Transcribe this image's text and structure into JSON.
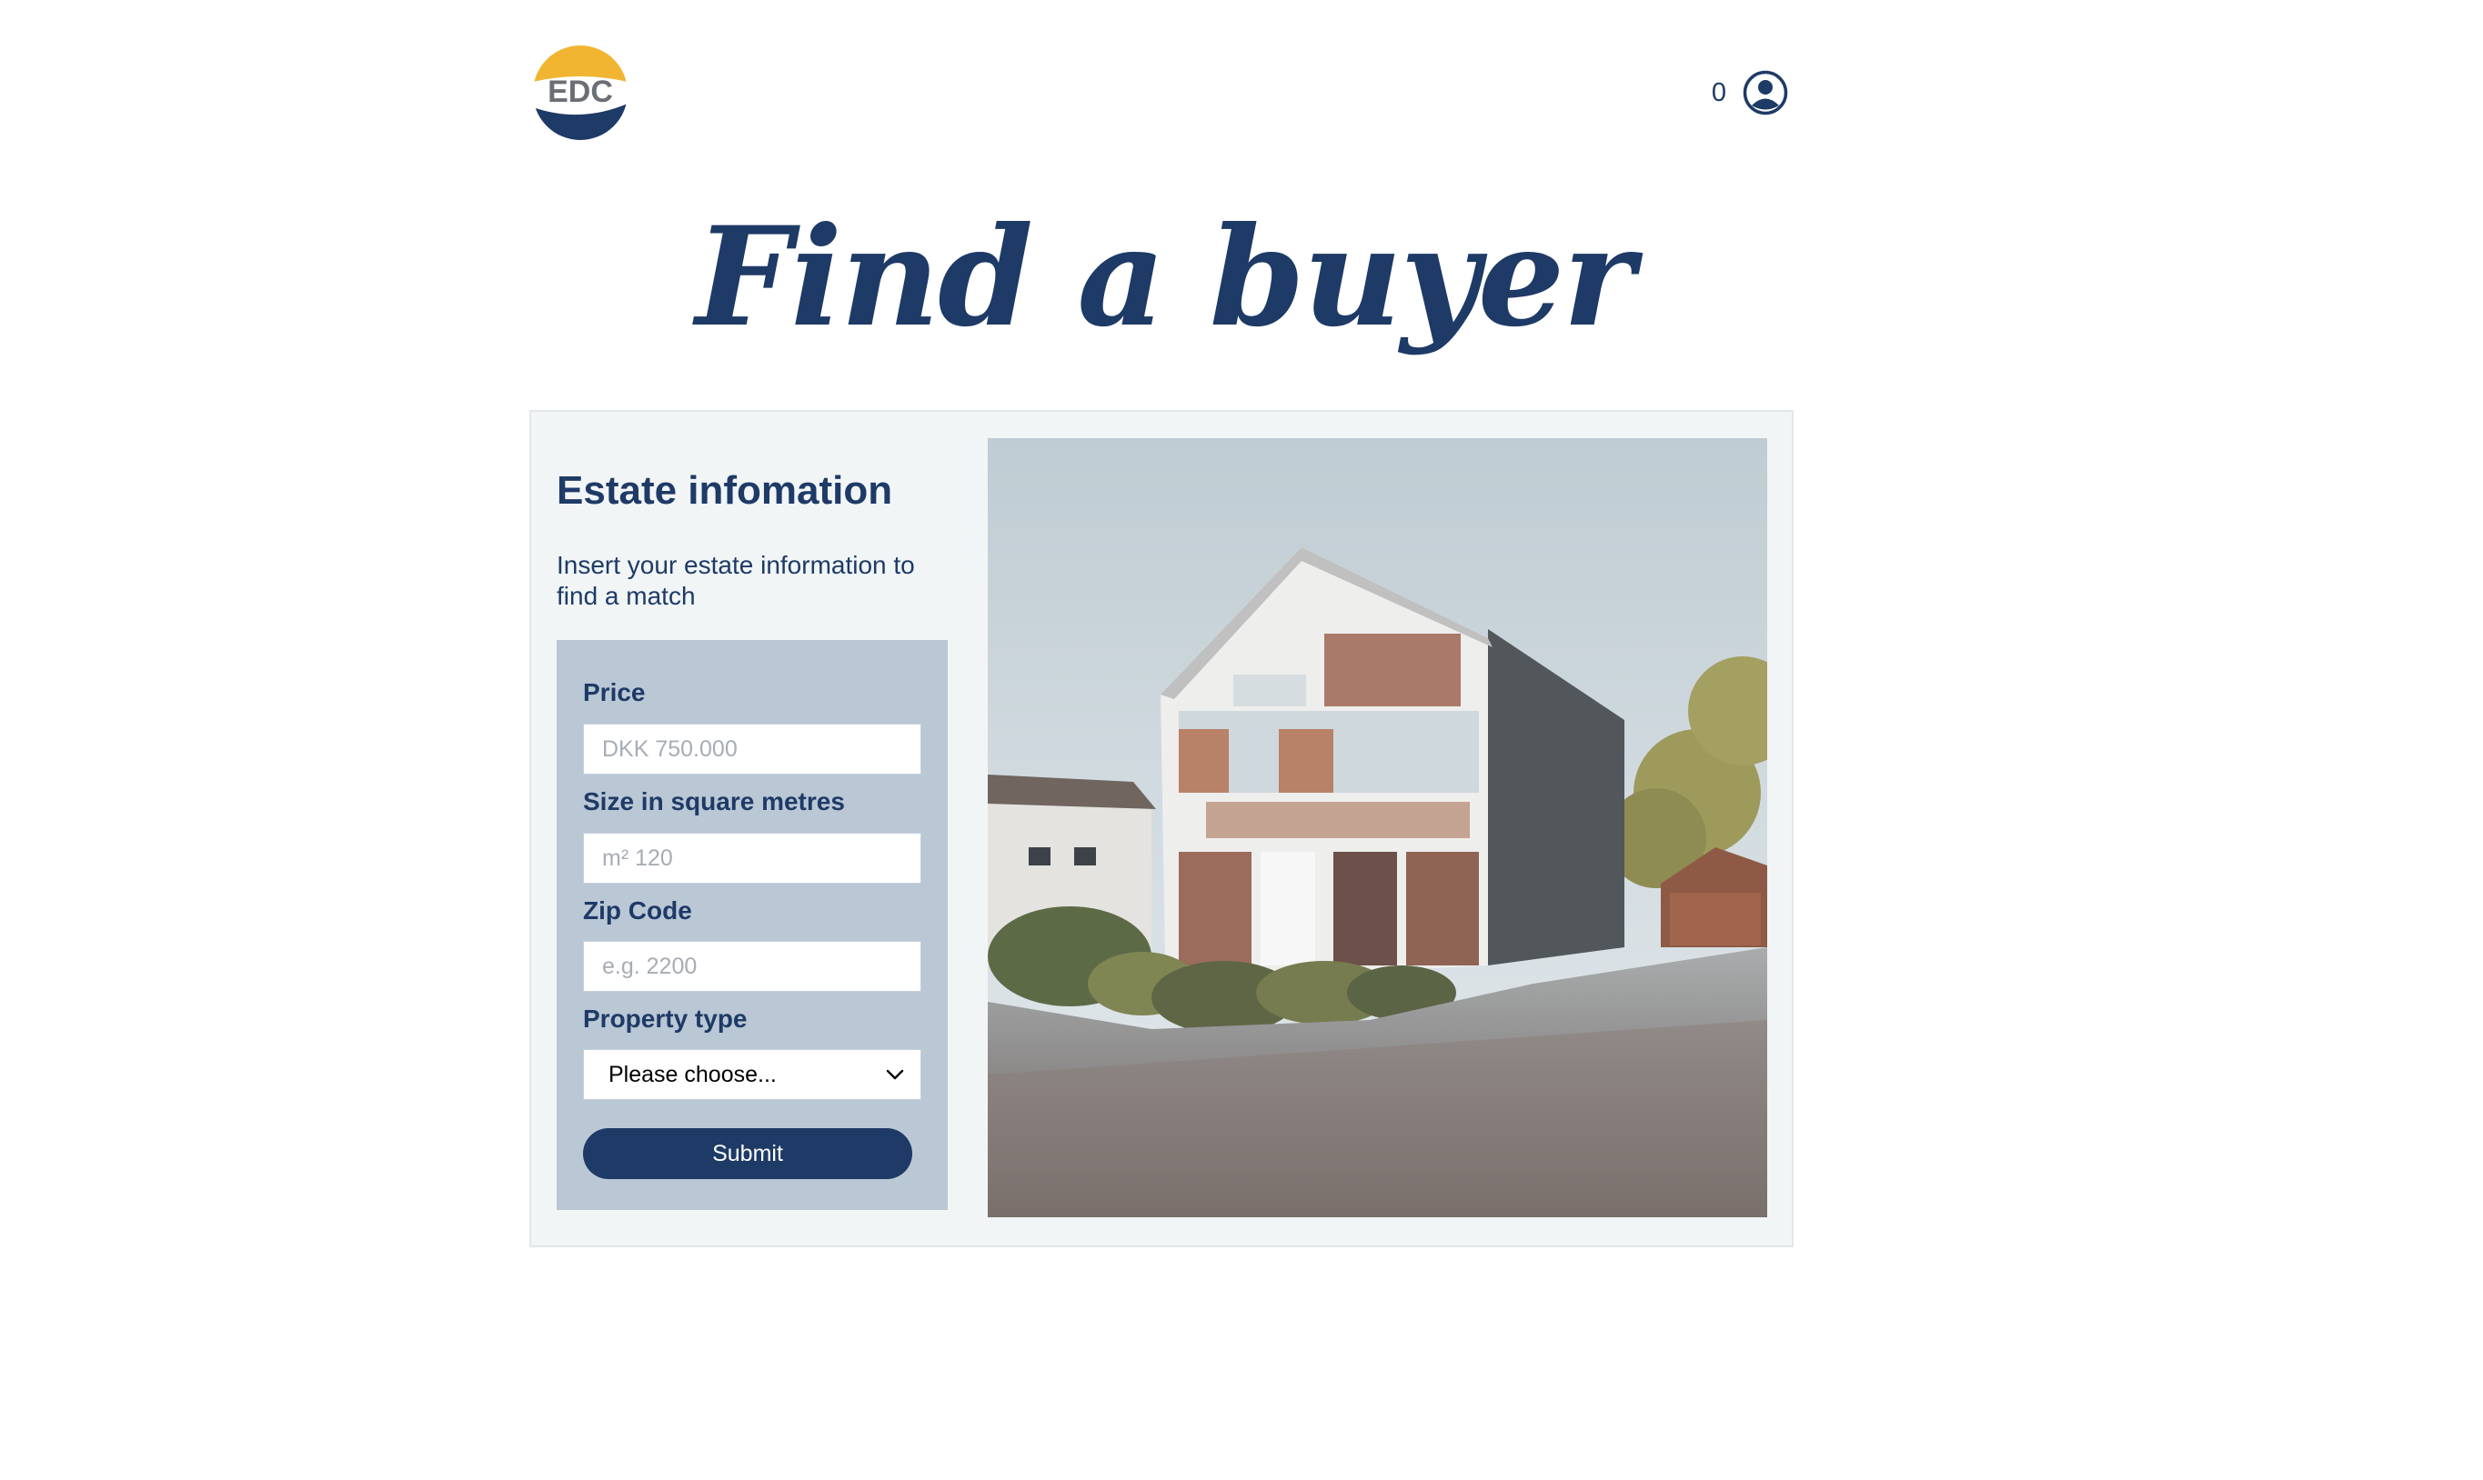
{
  "header": {
    "logo_text": "EDC",
    "count": "0",
    "user_icon": "user-circle-icon"
  },
  "page": {
    "title": "Find a buyer"
  },
  "card": {
    "heading": "Estate infomation",
    "intro": "Insert your estate information to find a match",
    "form": {
      "price_label": "Price",
      "price_placeholder": "DKK 750.000",
      "size_label": "Size in square metres",
      "size_placeholder": "m² 120",
      "zip_label": "Zip Code",
      "zip_placeholder": "e.g. 2200",
      "type_label": "Property type",
      "type_value": "Please choose...",
      "submit_label": "Submit"
    }
  },
  "colors": {
    "brand": "#1e3a66",
    "logo_yellow": "#f1b532",
    "form_background": "#bac7d5",
    "card_background": "#f1f5f6"
  }
}
